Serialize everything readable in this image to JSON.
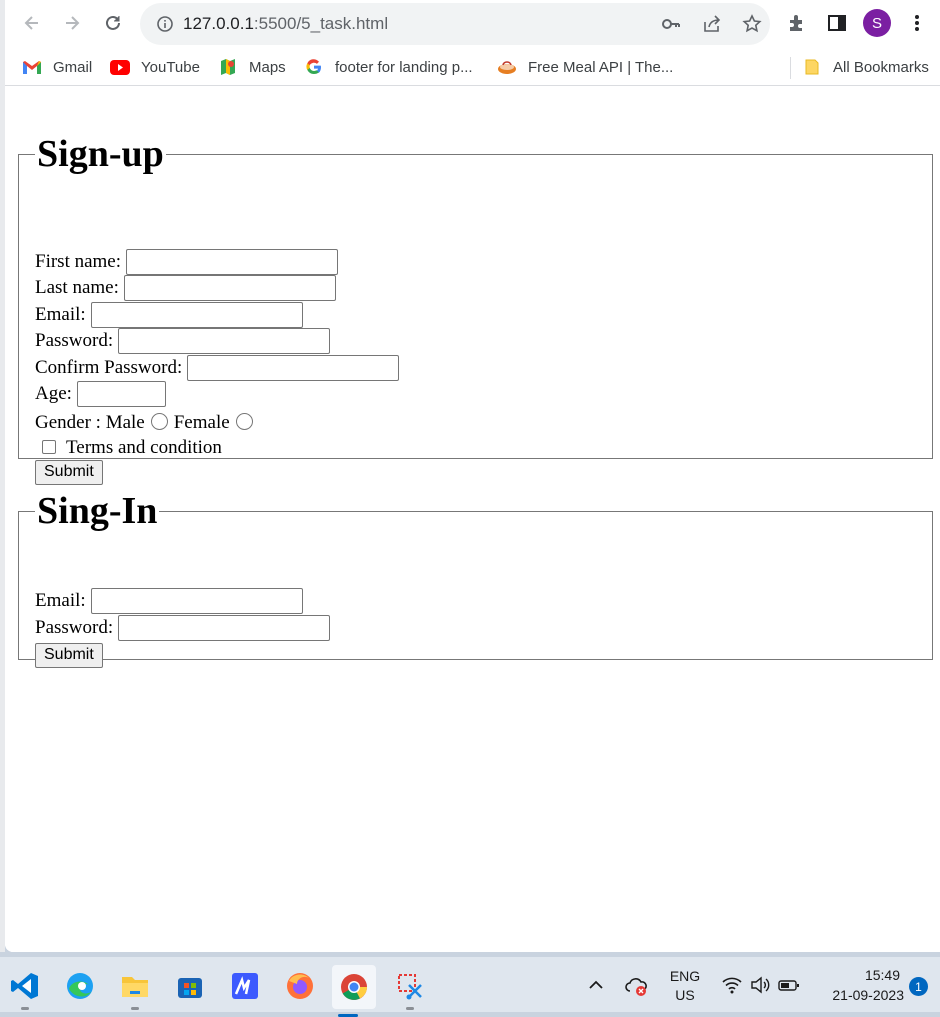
{
  "browser": {
    "url_host": "127.0.0.1",
    "url_path": ":5500/5_task.html",
    "profile_initial": "S",
    "bookmarks": [
      {
        "label": "Gmail",
        "icon": "gmail-icon"
      },
      {
        "label": "YouTube",
        "icon": "youtube-icon"
      },
      {
        "label": "Maps",
        "icon": "maps-icon"
      },
      {
        "label": "footer for landing p...",
        "icon": "google-icon"
      },
      {
        "label": "Free Meal API | The...",
        "icon": "meal-icon"
      }
    ],
    "all_bookmarks_label": "All Bookmarks"
  },
  "signup": {
    "legend": "Sign-up",
    "first_name_label": "First name:",
    "last_name_label": "Last name:",
    "email_label": "Email:",
    "password_label": "Password:",
    "confirm_password_label": "Confirm Password:",
    "age_label": "Age:",
    "gender_label": "Gender : Male",
    "female_label": "Female",
    "terms_label": "Terms and condition",
    "submit_label": "Submit"
  },
  "signin": {
    "legend": "Sing-In",
    "email_label": "Email:",
    "password_label": "Password:",
    "submit_label": "Submit"
  },
  "taskbar": {
    "language": "ENG",
    "region": "US",
    "time": "15:49",
    "date": "21-09-2023",
    "notification_count": "1"
  },
  "colors": {
    "accent": "#0067c0",
    "avatar": "#7b1fa2"
  }
}
